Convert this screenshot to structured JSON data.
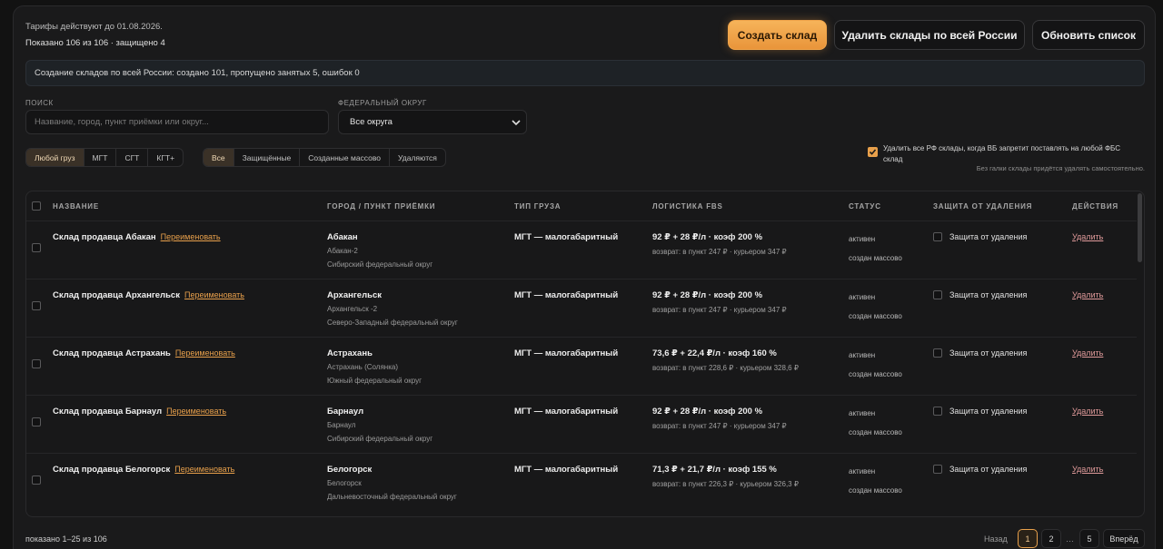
{
  "header": {
    "tariff_note": "Тарифы действуют до 01.08.2026.",
    "shown_count": "Показано 106 из 106 · защищено 4"
  },
  "toolbar": {
    "create_label": "Создать склад",
    "delete_all_label": "Удалить склады по всей России",
    "refresh_label": "Обновить список"
  },
  "notice": "Создание складов по всей России: создано 101, пропущено занятых 5, ошибок 0",
  "filters": {
    "search_label": "ПОИСК",
    "search_placeholder": "Название, город, пункт приёмки или округ...",
    "district_label": "ФЕДЕРАЛЬНЫЙ ОКРУГ",
    "district_value": "Все округа",
    "cargo_tabs": [
      "Любой груз",
      "МГТ",
      "СГТ",
      "КГТ+"
    ],
    "status_tabs": [
      "Все",
      "Защищённые",
      "Созданные массово",
      "Удаляются"
    ],
    "auto_delete_label": "Удалить все РФ склады, когда ВБ запретит поставлять на любой ФБС склад",
    "auto_delete_hint": "Без галки склады придётся удалять самостоятельно."
  },
  "table": {
    "columns": [
      "НАЗВАНИЕ",
      "ГОРОД / ПУНКТ ПРИЁМКИ",
      "ТИП ГРУЗА",
      "ЛОГИСТИКА FBS",
      "СТАТУС",
      "ЗАЩИТА ОТ УДАЛЕНИЯ",
      "ДЕЙСТВИЯ"
    ],
    "rename_label": "Переименовать",
    "protect_label": "Защита от удаления",
    "delete_label": "Удалить",
    "rows": [
      {
        "name": "Склад продавца Абакан",
        "city": "Абакан",
        "point": "Абакан-2",
        "district": "Сибирский федеральный округ",
        "cargo": "МГТ — малогабаритный",
        "price": "92 ₽ + 28 ₽/л · коэф 200 %",
        "ret": "возврат: в пункт 247 ₽ · курьером 347 ₽",
        "status": "активен",
        "status2": "создан массово"
      },
      {
        "name": "Склад продавца Архангельск",
        "city": "Архангельск",
        "point": "Архангельск -2",
        "district": "Северо-Западный федеральный округ",
        "cargo": "МГТ — малогабаритный",
        "price": "92 ₽ + 28 ₽/л · коэф 200 %",
        "ret": "возврат: в пункт 247 ₽ · курьером 347 ₽",
        "status": "активен",
        "status2": "создан массово"
      },
      {
        "name": "Склад продавца Астрахань",
        "city": "Астрахань",
        "point": "Астрахань (Солянка)",
        "district": "Южный федеральный округ",
        "cargo": "МГТ — малогабаритный",
        "price": "73,6 ₽ + 22,4 ₽/л · коэф 160 %",
        "ret": "возврат: в пункт 228,6 ₽ · курьером 328,6 ₽",
        "status": "активен",
        "status2": "создан массово"
      },
      {
        "name": "Склад продавца Барнаул",
        "city": "Барнаул",
        "point": "Барнаул",
        "district": "Сибирский федеральный округ",
        "cargo": "МГТ — малогабаритный",
        "price": "92 ₽ + 28 ₽/л · коэф 200 %",
        "ret": "возврат: в пункт 247 ₽ · курьером 347 ₽",
        "status": "активен",
        "status2": "создан массово"
      },
      {
        "name": "Склад продавца Белогорск",
        "city": "Белогорск",
        "point": "Белогорск",
        "district": "Дальневосточный федеральный округ",
        "cargo": "МГТ — малогабаритный",
        "price": "71,3 ₽ + 21,7 ₽/л · коэф 155 %",
        "ret": "возврат: в пункт 226,3 ₽ · курьером 326,3 ₽",
        "status": "активен",
        "status2": "создан массово"
      }
    ]
  },
  "pagination": {
    "summary": "показано 1–25 из 106",
    "prev": "Назад",
    "pages": [
      "1",
      "2",
      "…",
      "5"
    ],
    "next": "Вперёд"
  },
  "colors": {
    "accent": "#e8a04b",
    "background": "#121212",
    "delete_link": "#e09a9a"
  },
  "icons": {
    "select": "chevron-down-icon",
    "checkbox": "checkmark-icon"
  }
}
